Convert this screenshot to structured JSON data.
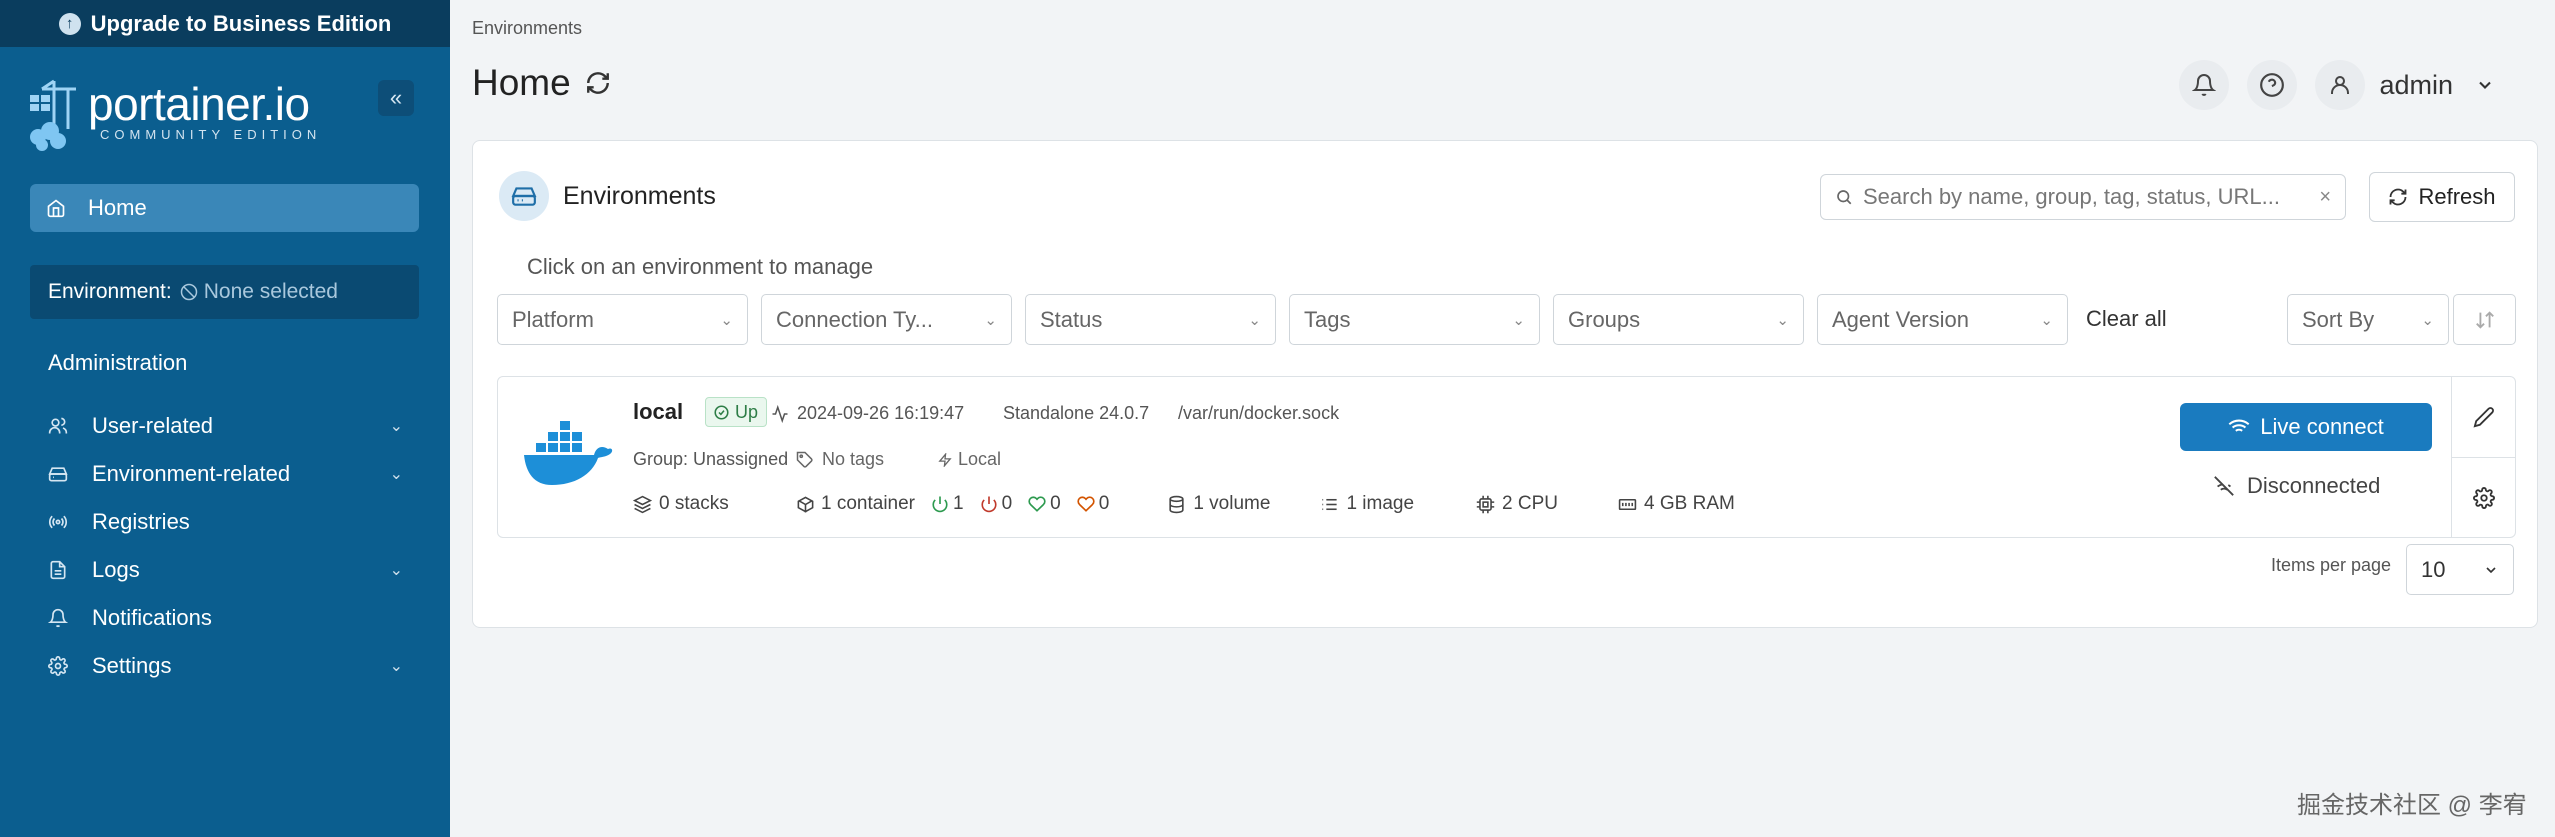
{
  "sidebar": {
    "upgrade_label": "Upgrade to Business Edition",
    "logo_text": "portainer.io",
    "logo_subtitle": "COMMUNITY EDITION",
    "home_label": "Home",
    "environment_label": "Environment:",
    "environment_value": "None selected",
    "admin_heading": "Administration",
    "items": [
      {
        "label": "User-related",
        "icon": "users-icon",
        "expandable": true
      },
      {
        "label": "Environment-related",
        "icon": "server-icon",
        "expandable": true
      },
      {
        "label": "Registries",
        "icon": "radio-icon",
        "expandable": false
      },
      {
        "label": "Logs",
        "icon": "file-text-icon",
        "expandable": true
      },
      {
        "label": "Notifications",
        "icon": "bell-icon",
        "expandable": false
      },
      {
        "label": "Settings",
        "icon": "gear-icon",
        "expandable": true
      }
    ]
  },
  "header": {
    "breadcrumb": "Environments",
    "title": "Home",
    "user_name": "admin"
  },
  "environments": {
    "title": "Environments",
    "search_placeholder": "Search by name, group, tag, status, URL...",
    "refresh_label": "Refresh",
    "hint": "Click on an environment to manage",
    "filters": [
      "Platform",
      "Connection Ty...",
      "Status",
      "Tags",
      "Groups",
      "Agent Version"
    ],
    "clear_all": "Clear all",
    "sort_by": "Sort By",
    "items_per_page_label": "Items per page",
    "items_per_page_value": "10"
  },
  "environment": {
    "name": "local",
    "status": "Up",
    "heartbeat": "2024-09-26 16:19:47",
    "type": "Standalone 24.0.7",
    "url": "/var/run/docker.sock",
    "group": "Group: Unassigned",
    "tags": "No tags",
    "connection": "Local",
    "stacks": "0 stacks",
    "containers": "1 container",
    "running": "1",
    "stopped": "0",
    "healthy": "0",
    "unhealthy": "0",
    "volumes": "1 volume",
    "images": "1 image",
    "cpu": "2 CPU",
    "ram": "4 GB RAM",
    "live_connect": "Live connect",
    "connection_status": "Disconnected"
  },
  "colors": {
    "sidebar": "#0b5e8f",
    "sidebar_top": "#0a3d5e",
    "accent": "#1a7bbf",
    "up": "#2d7d46",
    "stopped": "#c0392b"
  },
  "watermark": "掘金技术社区 @ 李宥"
}
